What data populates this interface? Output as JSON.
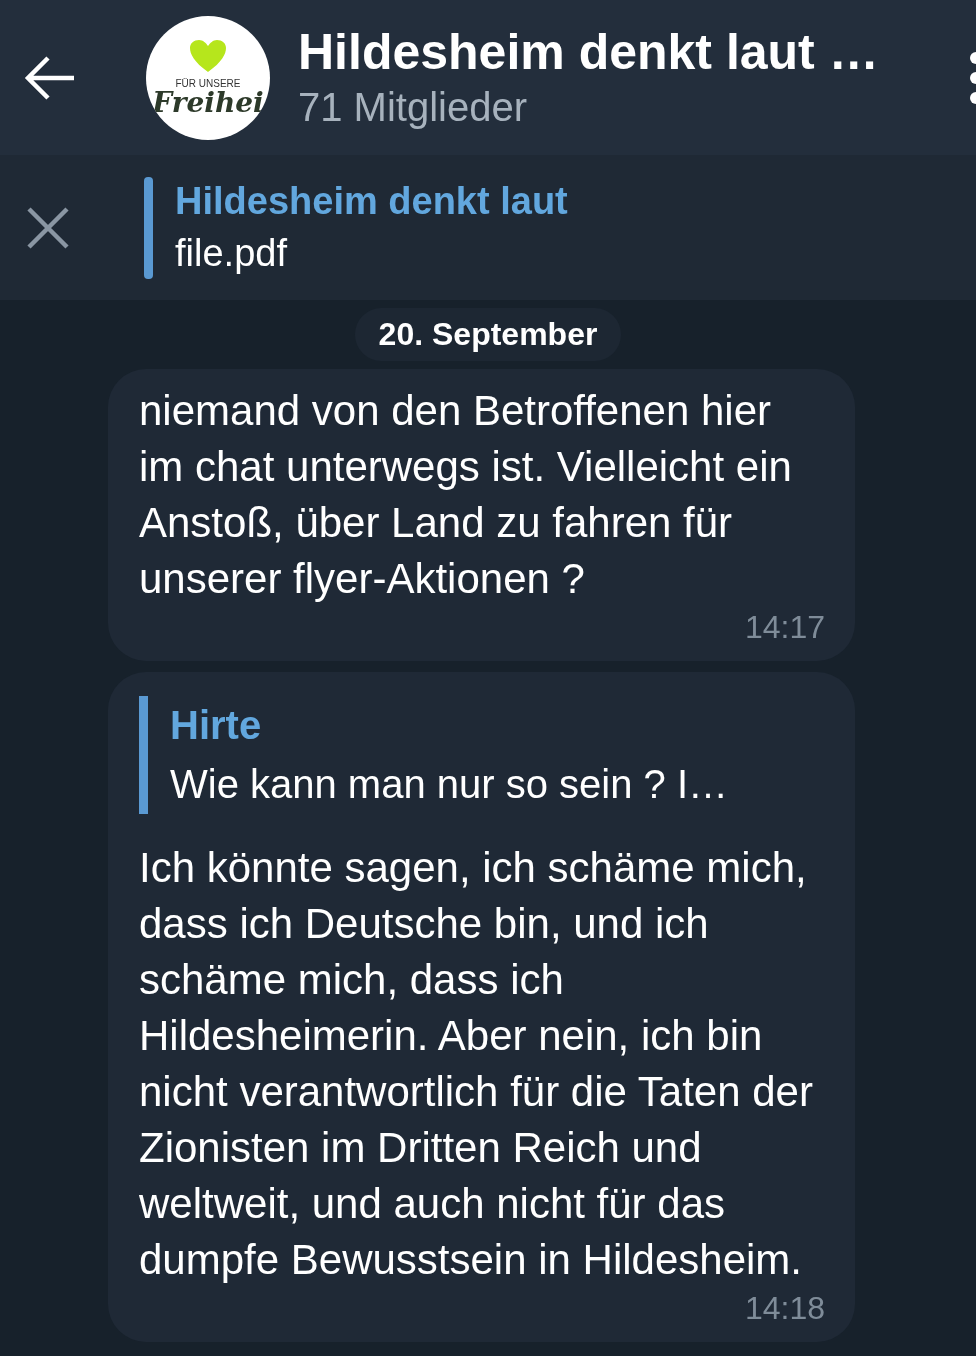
{
  "header": {
    "title": "Hildesheim denkt laut …",
    "subtitle": "71 Mitglieder",
    "avatar": {
      "line_1": "FÜR UNSERE",
      "line_2": "Freihei"
    }
  },
  "pinned": {
    "title": "Hildesheim denkt laut",
    "text": "file.pdf"
  },
  "date_label": "20. September",
  "messages": [
    {
      "text": "niemand von den Betroffenen hier im chat unterwegs ist. Vielleicht ein Anstoß, über Land zu fahren für unserer flyer-Aktionen ?",
      "time": "14:17"
    },
    {
      "reply": {
        "name": "Hirte",
        "text": "Wie kann man nur so sein ? I…"
      },
      "text": "Ich könnte sagen, ich schäme mich, dass ich Deutsche bin, und ich schäme mich, dass ich Hildesheimerin. Aber nein, ich bin nicht verantwortlich für die Taten der Zionisten im Dritten Reich und weltweit, und auch nicht für das dumpfe Bewusstsein in Hildesheim.",
      "time": "14:18"
    }
  ]
}
